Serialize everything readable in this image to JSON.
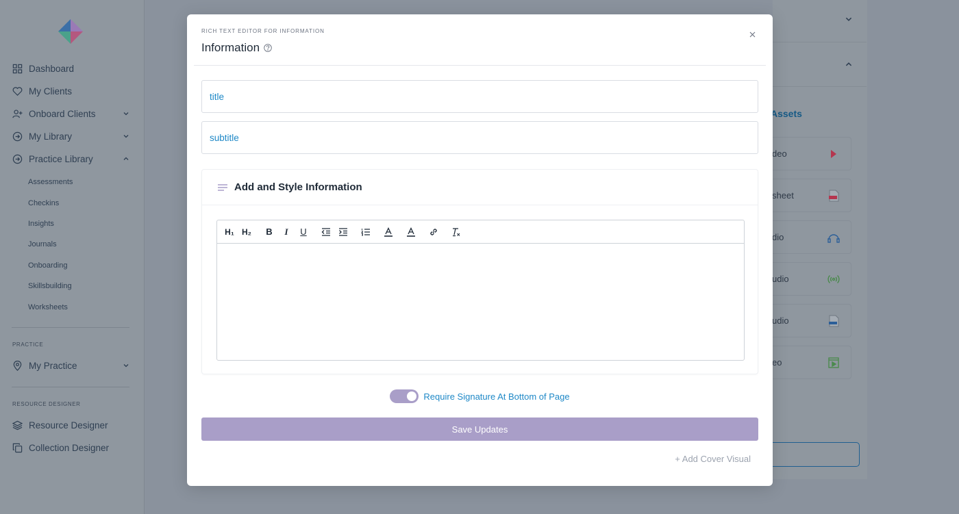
{
  "sidebar": {
    "nav": [
      {
        "label": "Dashboard",
        "icon": "grid-icon"
      },
      {
        "label": "My Clients",
        "icon": "heart-icon"
      },
      {
        "label": "Onboard Clients",
        "icon": "user-plus-icon"
      },
      {
        "label": "My Library",
        "icon": "arrow-circle-icon"
      },
      {
        "label": "Practice Library",
        "icon": "arrow-circle-icon"
      }
    ],
    "practice_library_items": [
      "Assessments",
      "Checkins",
      "Insights",
      "Journals",
      "Onboarding",
      "Skillsbuilding",
      "Worksheets"
    ],
    "practice_section_label": "PRACTICE",
    "my_practice": "My Practice",
    "resource_designer_label": "RESOURCE DESIGNER",
    "resource_designer": "Resource Designer",
    "collection_designer": "Collection Designer"
  },
  "background": {
    "assets_label": "Assets",
    "cards": [
      "deo",
      "sheet",
      "dio",
      "udio",
      "udio",
      "eo"
    ]
  },
  "modal": {
    "eyebrow": "RICH TEXT EDITOR FOR INFORMATION",
    "title": "Information",
    "title_placeholder": "title",
    "subtitle_placeholder": "subtitle",
    "card_heading": "Add and Style Information",
    "toolbar_glyphs": {
      "h1": "H₁",
      "h2": "H₂",
      "bold": "B",
      "italic": "I",
      "underline": "U"
    },
    "toggle_label": "Require Signature At Bottom of Page",
    "toggle_on": true,
    "save_label": "Save Updates",
    "add_cover_label": "+ Add Cover Visual"
  },
  "colors": {
    "accent_purple": "#a99ec8",
    "link_blue": "#1e88c7",
    "overlay_bg": "#8a929d"
  }
}
